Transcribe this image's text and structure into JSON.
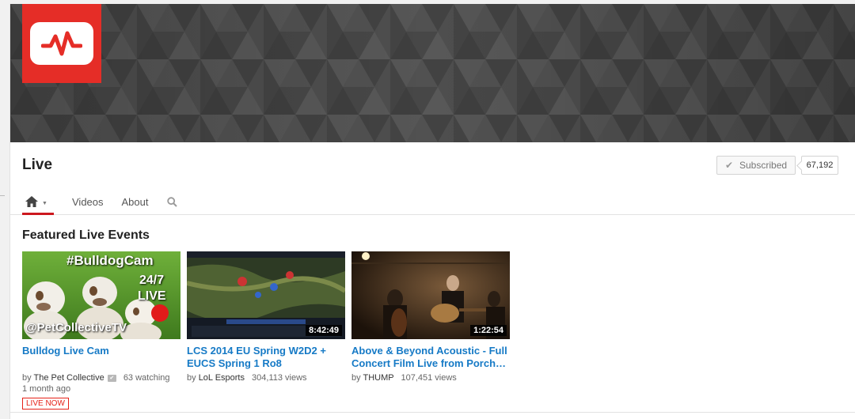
{
  "channel": {
    "title": "Live",
    "subscribe_label": "Subscribed",
    "subscriber_count": "67,192",
    "brand_color": "#e52d27"
  },
  "nav": {
    "home_icon": "home-icon",
    "items": [
      "Videos",
      "About"
    ],
    "search_icon": "search-icon"
  },
  "section": {
    "title": "Featured Live Events"
  },
  "thumb_text": {
    "bulldog_hashtag": "#BulldogCam",
    "bulldog_247": "24/7",
    "bulldog_live": "LIVE",
    "bulldog_handle": "@PetCollectiveTV"
  },
  "videos": [
    {
      "title": "Bulldog Live Cam",
      "by": "by",
      "owner": "The Pet Collective",
      "stat": "63 watching",
      "age": "1 month ago",
      "badge": "LIVE NOW"
    },
    {
      "title": "LCS 2014 EU Spring W2D2 + EUCS Spring 1 Ro8",
      "by": "by",
      "owner": "LoL Esports",
      "stat": "304,113 views",
      "duration": "8:42:49"
    },
    {
      "title": "Above & Beyond Acoustic - Full Concert Film Live from Porch…",
      "by": "by",
      "owner": "THUMP",
      "stat": "107,451 views",
      "duration": "1:22:54"
    }
  ]
}
